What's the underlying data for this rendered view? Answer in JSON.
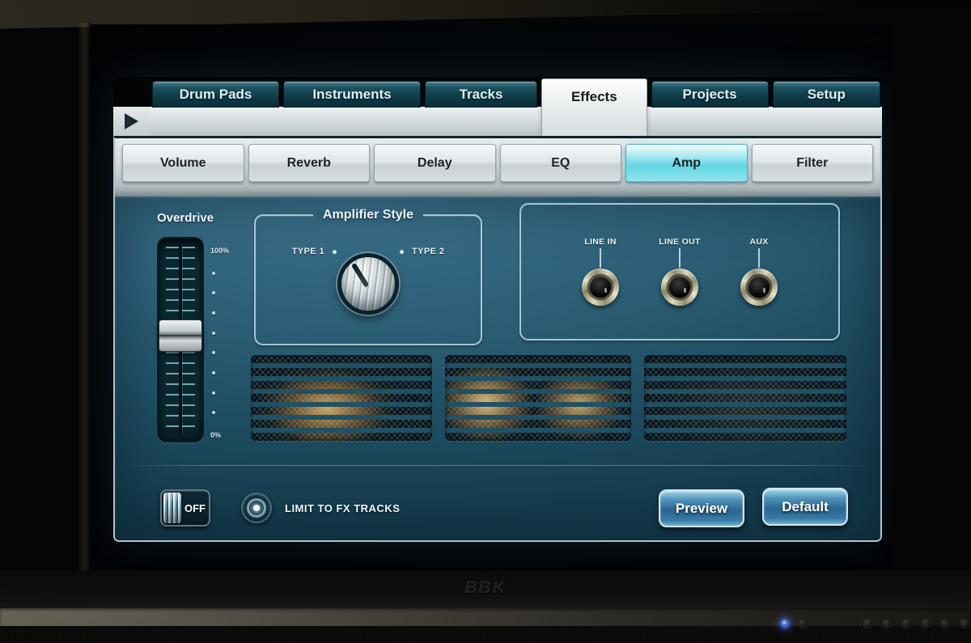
{
  "monitor": {
    "brand": "BBK",
    "power_led_color": "#4a6bff",
    "chassis_button_count": 7
  },
  "app": {
    "icons": {
      "play": "triangle-right"
    },
    "top_tabs": [
      {
        "label": "Drum Pads",
        "active": false
      },
      {
        "label": "Instruments",
        "active": false
      },
      {
        "label": "Tracks",
        "active": false
      },
      {
        "label": "Effects",
        "active": true
      },
      {
        "label": "Projects",
        "active": false
      },
      {
        "label": "Setup",
        "active": false
      }
    ],
    "effect_tabs": [
      {
        "label": "Volume",
        "active": false
      },
      {
        "label": "Reverb",
        "active": false
      },
      {
        "label": "Delay",
        "active": false
      },
      {
        "label": "EQ",
        "active": false
      },
      {
        "label": "Amp",
        "active": true
      },
      {
        "label": "Filter",
        "active": false
      }
    ],
    "amp_page": {
      "overdrive": {
        "label": "Overdrive",
        "scale_max": "100%",
        "scale_min": "0%",
        "value_percent": 52
      },
      "amplifier_style": {
        "title": "Amplifier Style",
        "options": [
          "TYPE 1",
          "TYPE 2"
        ],
        "selected": "TYPE 1"
      },
      "jacks": [
        {
          "label": "LINE IN"
        },
        {
          "label": "LINE OUT"
        },
        {
          "label": "AUX"
        }
      ],
      "bypass_toggle": {
        "state": "OFF"
      },
      "limit_button": {
        "label": "LIMIT TO FX TRACKS"
      },
      "preview_button": {
        "label": "Preview"
      },
      "default_button": {
        "label": "Default"
      }
    },
    "colors": {
      "accent_cyan": "#62d6e4",
      "panel_teal": "#245668",
      "tube_glow_amber": "#f2c070",
      "button_blue": "#2a648f"
    }
  }
}
